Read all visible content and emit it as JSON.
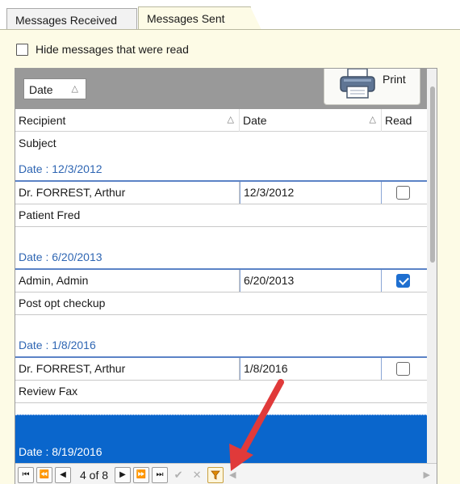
{
  "tabs": [
    {
      "label": "Messages Received",
      "active": false
    },
    {
      "label": "Messages Sent",
      "active": true
    }
  ],
  "hide_read": {
    "label": "Hide messages that were read",
    "checked": false
  },
  "group_panel": {
    "chip_label": "Date",
    "chip_sort": "△"
  },
  "print_button": {
    "label": "Print",
    "icon": "printer-icon"
  },
  "columns": {
    "recipient": "Recipient",
    "date": "Date",
    "read": "Read",
    "subject": "Subject",
    "sort_glyph": "△"
  },
  "groups": [
    {
      "header": "Date : 12/3/2012",
      "recipient": "Dr. FORREST, Arthur",
      "date": "12/3/2012",
      "read": false,
      "subject": "Patient Fred"
    },
    {
      "header": "Date : 6/20/2013",
      "recipient": "Admin, Admin",
      "date": "6/20/2013",
      "read": true,
      "subject": "Post opt checkup"
    },
    {
      "header": "Date : 1/8/2016",
      "recipient": "Dr. FORREST, Arthur",
      "date": "1/8/2016",
      "read": false,
      "subject": "Review Fax"
    },
    {
      "header": "Date : 8/19/2016",
      "selected": true
    }
  ],
  "navigator": {
    "first": "⏮",
    "prev_page": "⏪",
    "prev": "◀",
    "position": "4 of 8",
    "next": "▶",
    "next_page": "⏩",
    "last": "⏭",
    "accept": "✔",
    "cancel": "✕",
    "filter": "▼",
    "scroll_left": "◀",
    "scroll_right": "▶"
  },
  "colors": {
    "accent": "#0a66cc",
    "group_text": "#2f66b3",
    "panel_bg": "#fdfbe6",
    "annotation_arrow": "#e03a3a"
  }
}
